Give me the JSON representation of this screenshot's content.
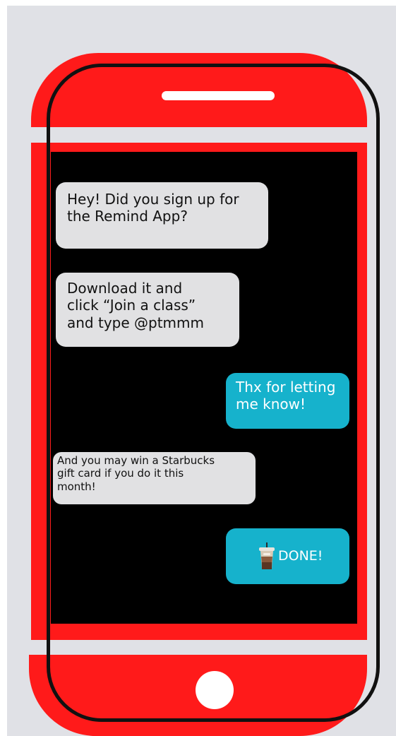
{
  "messages": [
    {
      "text": "Hey! Did you sign up for\nthe Remind App?",
      "side": "incoming"
    },
    {
      "text": "Download it and\nclick “Join a class”\nand type @ptmmm",
      "side": "incoming"
    },
    {
      "text": "Thx for letting\nme know!",
      "side": "outgoing"
    },
    {
      "text": "And you may win a Starbucks\ngift card if you do it this\nmonth!",
      "side": "incoming"
    },
    {
      "text": "DONE!",
      "side": "outgoing",
      "icon": "iced-coffee-icon"
    }
  ],
  "colors": {
    "background": "#e0e1e6",
    "phone_body": "#ff1a1a",
    "screen": "#000000",
    "incoming_bubble": "#e1e1e3",
    "outgoing_bubble": "#16b2cc",
    "outline": "#111111"
  }
}
